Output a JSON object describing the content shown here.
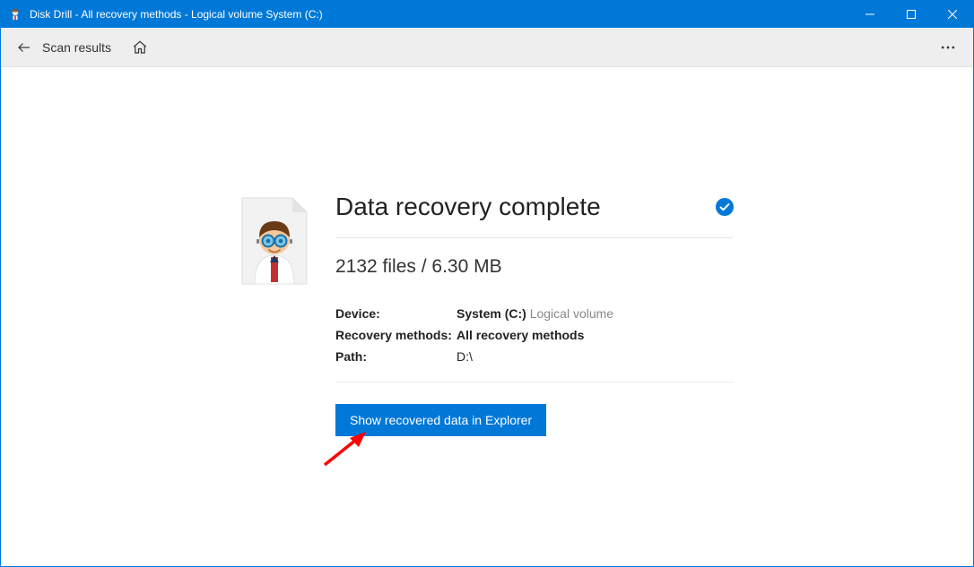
{
  "window": {
    "title": "Disk Drill - All recovery methods - Logical volume System (C:)"
  },
  "toolbar": {
    "back_label": "Back",
    "scan_results_label": "Scan results",
    "home_label": "Home",
    "more_label": "More"
  },
  "result": {
    "heading": "Data recovery complete",
    "summary": "2132 files / 6.30 MB",
    "device_label": "Device:",
    "device_value": "System (C:)",
    "device_suffix": "Logical volume",
    "methods_label": "Recovery methods:",
    "methods_value": "All recovery methods",
    "path_label": "Path:",
    "path_value": "D:\\",
    "action_button": "Show recovered data in Explorer"
  },
  "colors": {
    "accent": "#0078d7"
  }
}
